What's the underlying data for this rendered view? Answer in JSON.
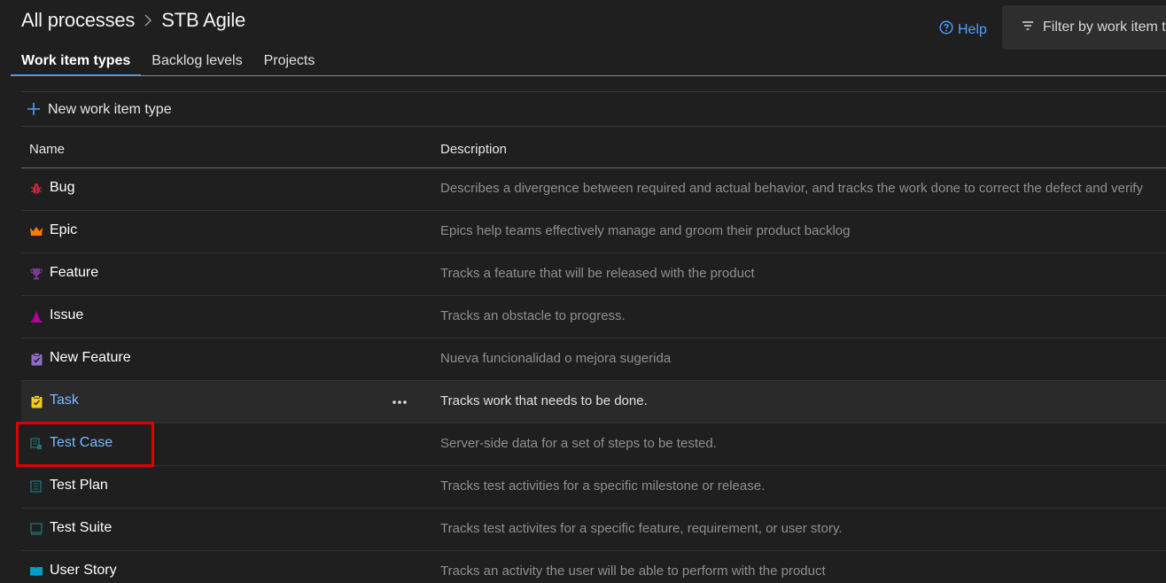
{
  "breadcrumb": {
    "root": "All processes",
    "current": "STB Agile"
  },
  "header": {
    "help_label": "Help",
    "filter_placeholder": "Filter by work item t"
  },
  "tabs": [
    {
      "label": "Work item types",
      "active": true
    },
    {
      "label": "Backlog levels",
      "active": false
    },
    {
      "label": "Projects",
      "active": false
    }
  ],
  "toolbar": {
    "new_label": "New work item type"
  },
  "columns": {
    "name": "Name",
    "description": "Description"
  },
  "rows": [
    {
      "name": "Bug",
      "icon": "bug-icon",
      "color": "#cc293d",
      "description": "Describes a divergence between required and actual behavior, and tracks the work done to correct the defect and verify"
    },
    {
      "name": "Epic",
      "icon": "crown-icon",
      "color": "#ff7b00",
      "description": "Epics help teams effectively manage and groom their product backlog"
    },
    {
      "name": "Feature",
      "icon": "trophy-icon",
      "color": "#773b93",
      "description": "Tracks a feature that will be released with the product"
    },
    {
      "name": "Issue",
      "icon": "issue-icon",
      "color": "#b4009e",
      "description": "Tracks an obstacle to progress."
    },
    {
      "name": "New Feature",
      "icon": "clipboard-icon",
      "color": "#8e6bc5",
      "description": "Nueva funcionalidad o mejora sugerida"
    },
    {
      "name": "Task",
      "icon": "clipboard-icon",
      "color": "#f2cb1d",
      "description": "Tracks work that needs to be done."
    },
    {
      "name": "Test Case",
      "icon": "test-case-icon",
      "color": "#004b50",
      "description": "Server-side data for a set of steps to be tested."
    },
    {
      "name": "Test Plan",
      "icon": "test-plan-icon",
      "color": "#004b50",
      "description": "Tracks test activities for a specific milestone or release."
    },
    {
      "name": "Test Suite",
      "icon": "test-suite-icon",
      "color": "#004b50",
      "description": "Tracks test activites for a specific feature, requirement, or user story."
    },
    {
      "name": "User Story",
      "icon": "book-icon",
      "color": "#009ccc",
      "description": "Tracks an activity the user will be able to perform with the product"
    }
  ],
  "hovered_row": "Task",
  "highlighted_row": "Test Case",
  "accent_color": "#4da3ff",
  "annotation_color": "#e00000"
}
